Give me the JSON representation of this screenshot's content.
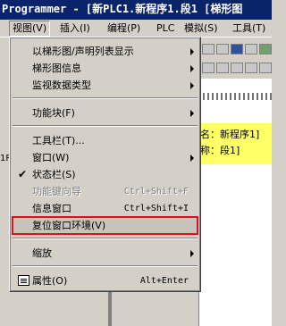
{
  "title": "Programmer - [新PLC1.新程序1.段1 [梯形图",
  "menubar": {
    "items": [
      "视图(V)",
      "插入(I)",
      "编程(P)",
      "PLC",
      "模拟(S)",
      "工具(T)"
    ]
  },
  "workarea": {
    "name_line": "名：新程序1]",
    "name_line2": "称：段1]",
    "left_label": "1R"
  },
  "menu": {
    "items": [
      {
        "label": "以梯形图/声明列表显示",
        "submenu": true
      },
      {
        "label": "梯形图信息",
        "submenu": true
      },
      {
        "label": "监视数据类型",
        "submenu": true
      },
      {
        "separator": true
      },
      {
        "label": "功能块(F)",
        "submenu": true
      },
      {
        "separator": true
      },
      {
        "label": "工具栏(T)..."
      },
      {
        "label": "窗口(W)",
        "submenu": true
      },
      {
        "label": "状态栏(S)",
        "checked": true
      },
      {
        "label": "功能键向导",
        "shortcut": "Ctrl+Shift+F",
        "disabled": true
      },
      {
        "label": "信息窗口",
        "shortcut": "Ctrl+Shift+I"
      },
      {
        "label": "复位窗口环境(V)",
        "highlighted": true
      },
      {
        "separator": true
      },
      {
        "label": "缩放",
        "submenu": true
      },
      {
        "separator": true
      },
      {
        "label": "属性(O)",
        "shortcut": "Alt+Enter",
        "icon": "properties-icon"
      }
    ]
  },
  "colors": {
    "highlight_box": "#e0101a",
    "title_bg": "#0a246a",
    "info_bg": "#ffff66"
  }
}
